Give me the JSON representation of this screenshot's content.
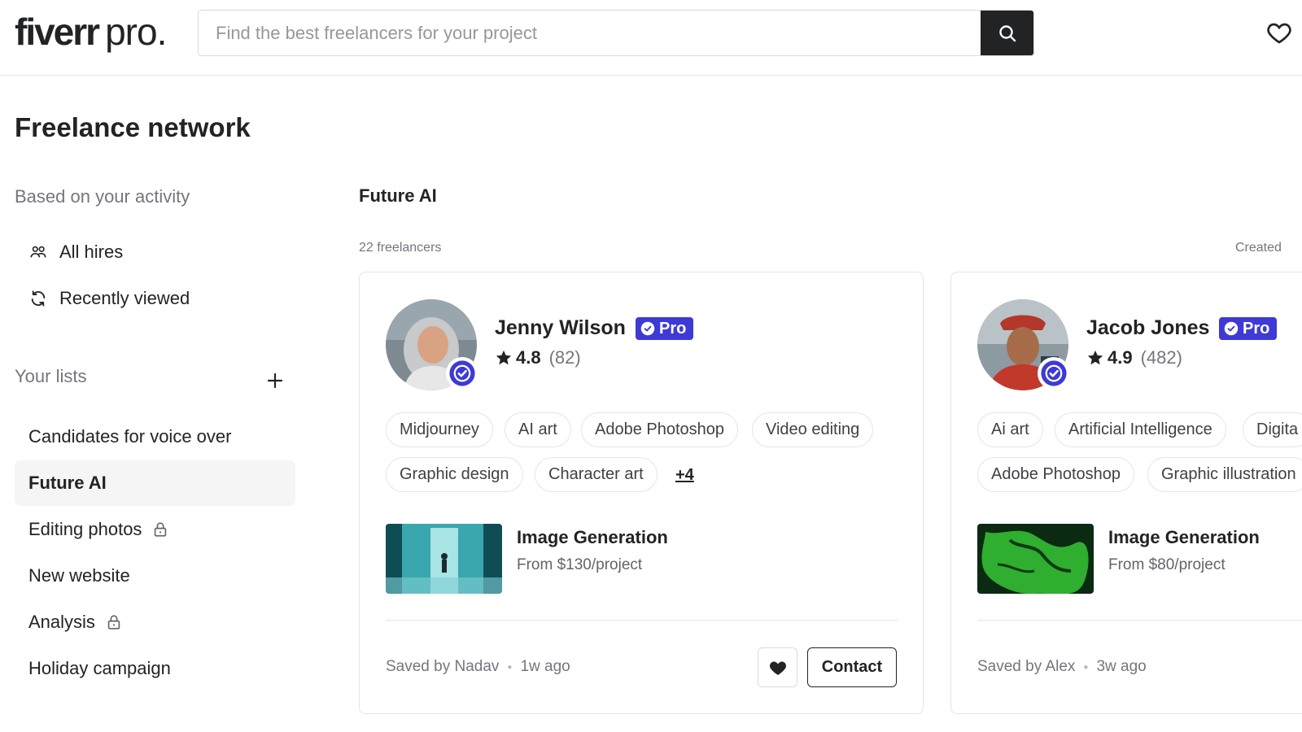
{
  "header": {
    "logo_main": "fiverr",
    "logo_pro": "pro.",
    "search_placeholder": "Find the best freelancers for your project"
  },
  "page_title": "Freelance network",
  "sidebar": {
    "activity_heading": "Based on your activity",
    "activity_items": [
      {
        "label": "All hires",
        "icon": "people-icon"
      },
      {
        "label": "Recently viewed",
        "icon": "refresh-icon"
      }
    ],
    "lists_heading": "Your lists",
    "lists": [
      {
        "label": "Candidates for voice over",
        "locked": false
      },
      {
        "label": "Future AI",
        "locked": false,
        "active": true
      },
      {
        "label": "Editing photos",
        "locked": true
      },
      {
        "label": "New website",
        "locked": false
      },
      {
        "label": "Analysis",
        "locked": true
      },
      {
        "label": "Holiday campaign",
        "locked": false
      }
    ]
  },
  "main": {
    "title": "Future AI",
    "count": "22 freelancers",
    "sort_label": "Created",
    "cards": [
      {
        "name": "Jenny Wilson",
        "badge": "Pro",
        "rating": "4.8",
        "reviews": "(82)",
        "tags": [
          "Midjourney",
          "AI art",
          "Adobe Photoshop",
          "Video editing",
          "Graphic design",
          "Character art"
        ],
        "more": "+4",
        "gig_title": "Image Generation",
        "gig_price": "From $130/project",
        "saved_by": "Saved by Nadav",
        "saved_time": "1w ago",
        "contact": "Contact"
      },
      {
        "name": "Jacob Jones",
        "badge": "Pro",
        "rating": "4.9",
        "reviews": "(482)",
        "tags": [
          "Ai art",
          "Artificial Intelligence",
          "Digita",
          "Adobe Photoshop",
          "Graphic illustration"
        ],
        "gig_title": "Image Generation",
        "gig_price": "From $80/project",
        "saved_by": "Saved by Alex",
        "saved_time": "3w ago"
      }
    ]
  },
  "colors": {
    "pro_badge": "#3d3ad6",
    "search_button": "#222325",
    "active_list_bg": "#f5f5f5"
  }
}
